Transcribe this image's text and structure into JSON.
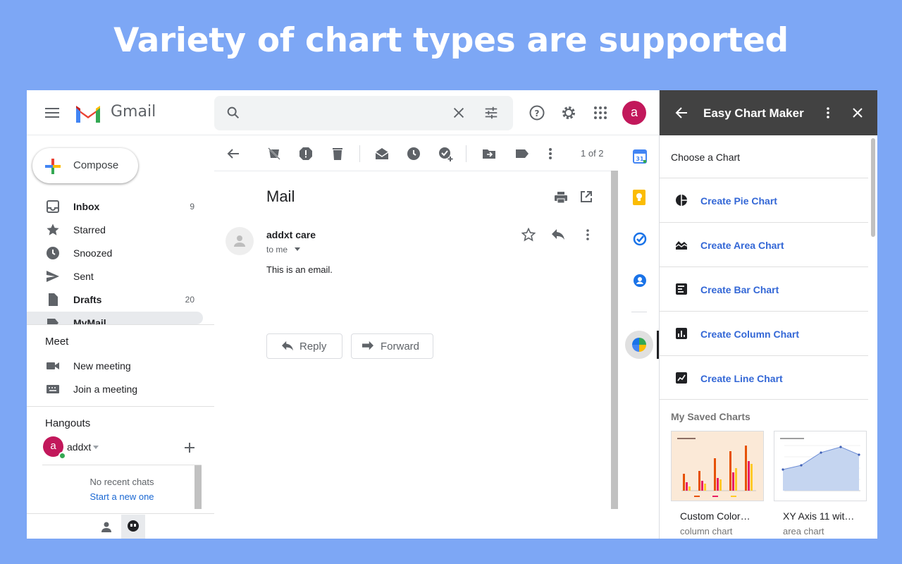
{
  "banner": {
    "headline": "Variety of chart types are supported"
  },
  "gmail": {
    "brand": "Gmail",
    "avatar_letter": "a",
    "compose": "Compose",
    "nav": [
      {
        "label": "Inbox",
        "count": "9"
      },
      {
        "label": "Starred",
        "count": ""
      },
      {
        "label": "Snoozed",
        "count": ""
      },
      {
        "label": "Sent",
        "count": ""
      },
      {
        "label": "Drafts",
        "count": "20"
      },
      {
        "label": "MyMail",
        "count": ""
      }
    ],
    "meet": {
      "title": "Meet",
      "new_meeting": "New meeting",
      "join_meeting": "Join a meeting"
    },
    "hangouts": {
      "title": "Hangouts",
      "user": "addxt",
      "user_letter": "a",
      "no_recent": "No recent chats",
      "start_new": "Start a new one"
    },
    "toolbar": {
      "pager": "1 of 2"
    },
    "message": {
      "subject": "Mail",
      "sender": "addxt care",
      "to": "to me",
      "body": "This is an email.",
      "reply": "Reply",
      "forward": "Forward"
    }
  },
  "panel": {
    "title": "Easy Chart Maker",
    "choose": "Choose a Chart",
    "options": [
      "Create Pie Chart",
      "Create Area Chart",
      "Create Bar Chart",
      "Create Column Chart",
      "Create Line Chart"
    ],
    "saved_title": "My Saved Charts",
    "saved": [
      {
        "name": "Custom Color…",
        "type": "column chart"
      },
      {
        "name": "XY Axis 11 wit…",
        "type": "area chart"
      }
    ]
  },
  "colors": {
    "banner_bg": "#7da7f5",
    "panel_header": "#424242",
    "link_blue": "#3367d6",
    "avatar": "#c2185b"
  }
}
